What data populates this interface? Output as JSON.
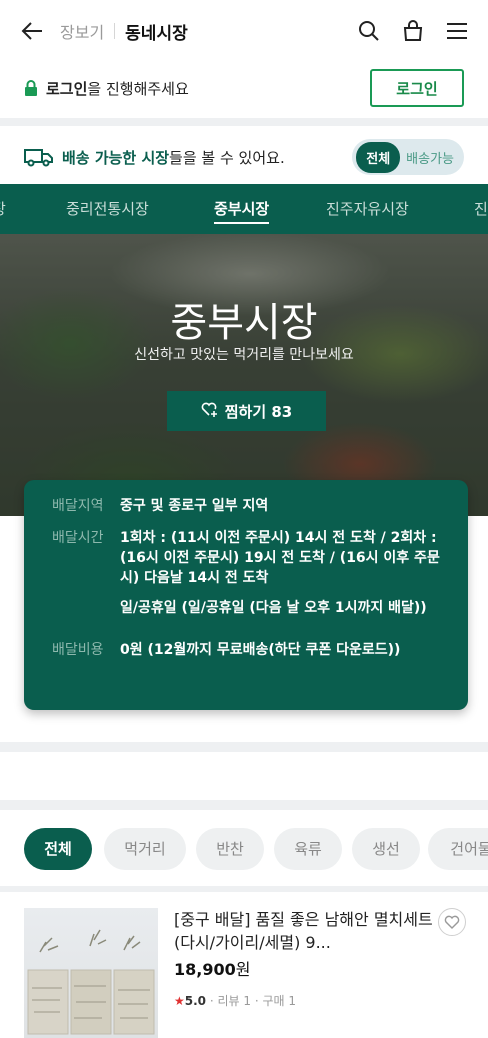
{
  "header": {
    "crumb_parent": "장보기",
    "crumb_current": "동네시장"
  },
  "login": {
    "message_bold": "로그인",
    "message_rest": "을 진행해주세요",
    "button_label": "로그인"
  },
  "delivery": {
    "highlight": "배송 가능한 시장",
    "rest": "들을 볼 수 있어요.",
    "toggle_on": "전체",
    "toggle_off": "배송가능"
  },
  "market_tabs": [
    "장",
    "중리전통시장",
    "중부시장",
    "진주자유시장",
    "진"
  ],
  "hero": {
    "title": "중부시장",
    "subtitle": "신선하고 맛있는 먹거리를 만나보세요",
    "like_label": "찜하기 83"
  },
  "info": {
    "area_label": "배달지역",
    "area_value": "중구 및 종로구 일부 지역",
    "time_label": "배달시간",
    "time_value_1": "1회차 : (11시 이전 주문시) 14시 전 도착 / 2회차 : (16시 이전 주문시) 19시 전 도착 / (16시 이후 주문시) 다음날 14시 전 도착",
    "time_value_2": "일/공휴일 (일/공휴일 (다음 날 오후 1시까지 배달))",
    "fee_label": "배달비용",
    "fee_value": "0원 (12월까지 무료배송(하단 쿠폰 다운로드))"
  },
  "categories": [
    "전체",
    "먹거리",
    "반찬",
    "육류",
    "생선",
    "건어물"
  ],
  "product": {
    "title": "[중구 배달] 품질 좋은 남해안 멸치세트(다시/가이리/세멸) 9...",
    "price_number": "18,900",
    "price_unit": "원",
    "rating": "5.0",
    "reviews": "리뷰 1",
    "purchases": "구매 1"
  }
}
